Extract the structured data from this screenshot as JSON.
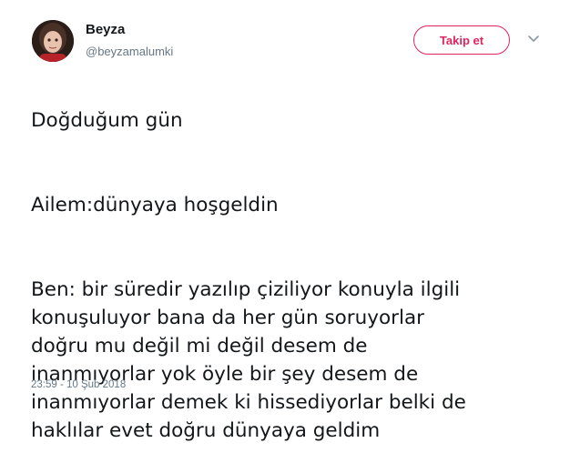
{
  "user": {
    "display_name": "Beyza",
    "handle": "@beyzamalumki",
    "avatar_icon": "profile-photo"
  },
  "header": {
    "follow_label": "Takip et",
    "menu_icon": "chevron-down-icon",
    "accent_color": "#e0245e"
  },
  "tweet": {
    "paragraphs": [
      "Doğduğum gün",
      "Ailem:dünyaya hoşgeldin",
      "Ben: bir süredir yazılıp çiziliyor konuyla ilgili\nkonuşuluyor bana da her gün soruyorlar\ndoğru mu değil mi değil desem de\ninanmıyorlar yok öyle bir şey desem de\ninanmıyorlar demek ki hissediyorlar belki de\nhaklılar evet doğru dünyaya geldim"
    ],
    "timestamp": "23:59 - 10 Şub 2018"
  }
}
